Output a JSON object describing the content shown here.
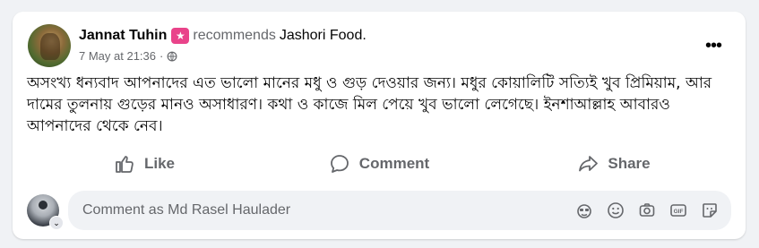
{
  "post": {
    "author": "Jannat Tuhin",
    "recommends_text": "recommends",
    "page_name": "Jashori Food",
    "period": ".",
    "timestamp": "7 May at 21:36",
    "separator": "·",
    "more_label": "•••",
    "text": "অসংখ্য ধন্যবাদ আপনাদের এত ভালো মানের মধু ও গুড় দেওয়ার জন্য। মধুর কোয়ালিটি সত্যিই খুব প্রিমিয়াম, আর দামের তুলনায় গুড়ের মানও অসাধারণ। কথা ও কাজে মিল পেয়ে খুব ভালো লেগেছে। ইনশাআল্লাহ আবারও আপনাদের থেকে নেব।"
  },
  "actions": {
    "like": "Like",
    "comment": "Comment",
    "share": "Share"
  },
  "comment_box": {
    "placeholder": "Comment as Md Rasel Haulader",
    "value": ""
  },
  "colors": {
    "badge": "#e9438a",
    "secondary_text": "#65676b",
    "background": "#f0f2f5"
  },
  "icons": {
    "badge": "star-badge-icon",
    "audience": "globe-icon",
    "more": "more-horizontal-icon",
    "like": "thumbs-up-icon",
    "comment": "speech-bubble-icon",
    "share": "share-arrow-icon",
    "tools": [
      "avatar-sticker-icon",
      "emoji-icon",
      "camera-icon",
      "gif-icon",
      "sticker-icon"
    ]
  }
}
